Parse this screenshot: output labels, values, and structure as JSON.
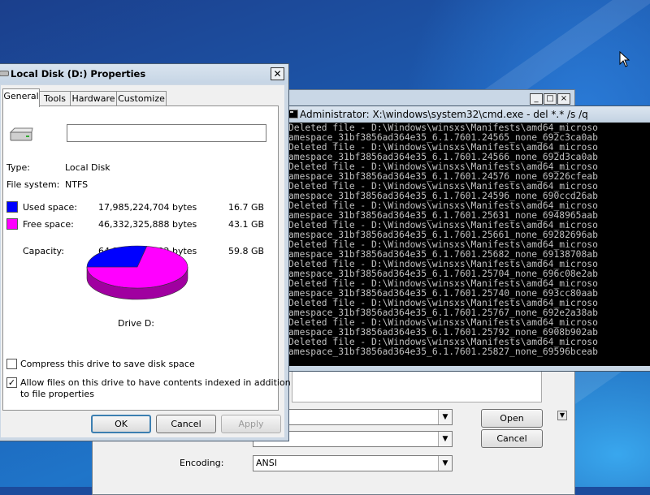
{
  "colors": {
    "used": "#0000ff",
    "free": "#ff00ff"
  },
  "save_dialog": {
    "open_label": "Open",
    "cancel_label": "Cancel",
    "encoding_label": "Encoding:",
    "encoding_value": "ANSI"
  },
  "cmd": {
    "title": "Administrator: X:\\windows\\system32\\cmd.exe - del  *.* /s /q",
    "lines": [
      "Deleted file - D:\\Windows\\winsxs\\Manifests\\amd64_microso",
      "amespace_31bf3856ad364e35_6.1.7601.24565_none_692c3ca0ab",
      "Deleted file - D:\\Windows\\winsxs\\Manifests\\amd64_microso",
      "amespace_31bf3856ad364e35_6.1.7601.24566_none_692d3ca0ab",
      "Deleted file - D:\\Windows\\winsxs\\Manifests\\amd64_microso",
      "amespace_31bf3856ad364e35_6.1.7601.24576_none_69226cfeab",
      "Deleted file - D:\\Windows\\winsxs\\Manifests\\amd64_microso",
      "amespace_31bf3856ad364e35_6.1.7601.24596_none_690ccd26ab",
      "Deleted file - D:\\Windows\\winsxs\\Manifests\\amd64_microso",
      "amespace_31bf3856ad364e35_6.1.7601.25631_none_6948965aab",
      "Deleted file - D:\\Windows\\winsxs\\Manifests\\amd64_microso",
      "amespace_31bf3856ad364e35_6.1.7601.25661_none_69282696ab",
      "Deleted file - D:\\Windows\\winsxs\\Manifests\\amd64_microso",
      "amespace_31bf3856ad364e35_6.1.7601.25682_none_69138708ab",
      "Deleted file - D:\\Windows\\winsxs\\Manifests\\amd64_microso",
      "amespace_31bf3856ad364e35_6.1.7601.25704_none_696c08e2ab",
      "Deleted file - D:\\Windows\\winsxs\\Manifests\\amd64_microso",
      "amespace_31bf3856ad364e35_6.1.7601.25740_none_693cc80aab",
      "Deleted file - D:\\Windows\\winsxs\\Manifests\\amd64_microso",
      "amespace_31bf3856ad364e35_6.1.7601.25767_none_692e2a38ab",
      "Deleted file - D:\\Windows\\winsxs\\Manifests\\amd64_microso",
      "amespace_31bf3856ad364e35_6.1.7601.25792_none_6908b902ab",
      "Deleted file - D:\\Windows\\winsxs\\Manifests\\amd64_microso",
      "amespace_31bf3856ad364e35_6.1.7601.25827_none_69596bceab"
    ]
  },
  "props": {
    "title": "Local Disk (D:) Properties",
    "tabs": [
      "General",
      "Tools",
      "Hardware",
      "Customize"
    ],
    "name_value": "",
    "type_label": "Type:",
    "type_value": "Local Disk",
    "fs_label": "File system:",
    "fs_value": "NTFS",
    "used_label": "Used space:",
    "used_bytes": "17,985,224,704 bytes",
    "used_gb": "16.7 GB",
    "free_label": "Free space:",
    "free_bytes": "46,332,325,888 bytes",
    "free_gb": "43.1 GB",
    "capacity_label": "Capacity:",
    "capacity_bytes": "64,317,550,592 bytes",
    "capacity_gb": "59.8 GB",
    "drive_label": "Drive D:",
    "used_fraction": 0.28,
    "compress_label": "Compress this drive to save disk space",
    "compress_checked": false,
    "index_label_1": "Allow files on this drive to have contents indexed in addition",
    "index_label_2": "to file properties",
    "index_checked": true,
    "ok_label": "OK",
    "cancel_label": "Cancel",
    "apply_label": "Apply"
  }
}
